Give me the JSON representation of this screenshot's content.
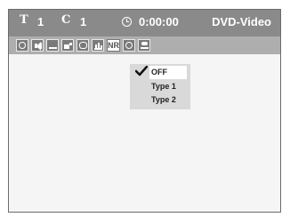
{
  "status": {
    "title_glyph": "T",
    "title_number": "1",
    "chapter_glyph": "C",
    "chapter_number": "1",
    "time": "0:00:00",
    "mode": "DVD-Video"
  },
  "toolbar": {
    "icons": [
      "search-icon",
      "audio-icon",
      "subtitle-icon",
      "angle-icon",
      "repeat-icon",
      "picture-icon",
      "nr-icon",
      "virtual-surround-icon",
      "dialogue-icon"
    ],
    "nr_label": "NR",
    "selected": "nr-icon"
  },
  "menu": {
    "options": [
      "OFF",
      "Type 1",
      "Type 2"
    ],
    "selected_index": 0
  }
}
